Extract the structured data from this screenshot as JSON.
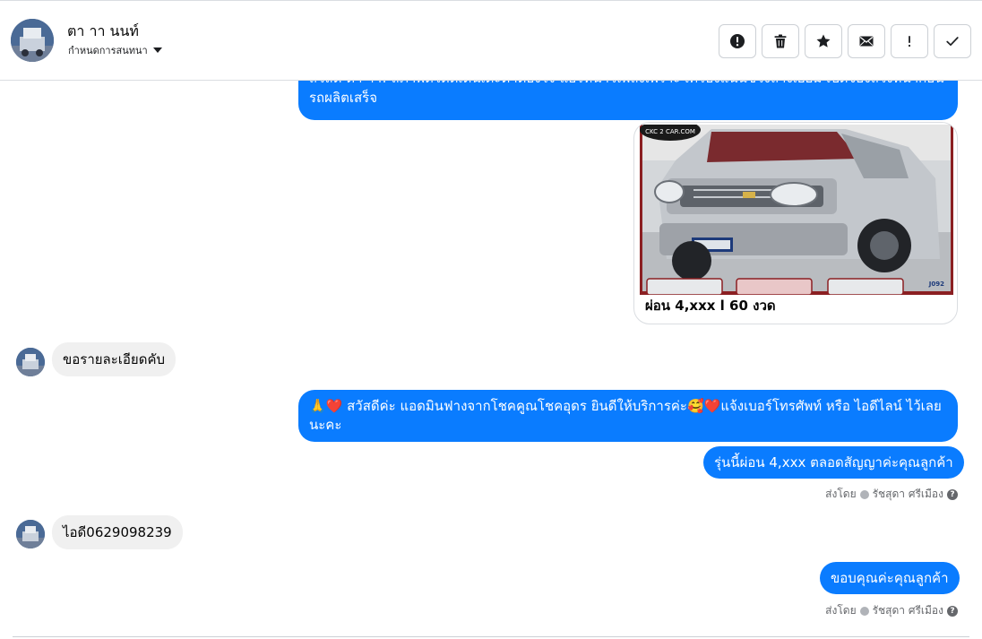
{
  "header": {
    "name": "ตา าา นนท์",
    "assign_label": "กำหนดการสนทนา",
    "toolbar": [
      {
        "name": "report-button",
        "icon": "alert-circle-icon"
      },
      {
        "name": "delete-button",
        "icon": "trash-icon"
      },
      {
        "name": "star-button",
        "icon": "star-icon"
      },
      {
        "name": "mark-unread-button",
        "icon": "envelope-icon"
      },
      {
        "name": "important-button",
        "icon": "exclamation-icon"
      },
      {
        "name": "done-button",
        "icon": "check-icon"
      }
    ]
  },
  "messages": [
    {
      "id": "m1",
      "direction": "out",
      "text_line1": "สวัสดี ตา าา! สภาพดีโดดเด่นเด่ะตาต้องใจ แอร์หนาวเพลงเพราะ เครื่องแน่นช่วงล่างเยี่ยม เปิดจองล่วงหน้าก่อน",
      "text_line2": "รถผลิตเสร็จ"
    },
    {
      "id": "m2",
      "direction": "out",
      "type": "card",
      "image_watermark": "CKC 2 CAR.COM",
      "image_code": "J092",
      "caption": "ผ่อน 4,xxx l 60 งวด"
    },
    {
      "id": "m3",
      "direction": "in",
      "text": "ขอรายละเอียดคับ"
    },
    {
      "id": "m4",
      "direction": "out",
      "emoji_prefix": "🙏❤️",
      "text_line1": " สวัสดีค่ะ แอดมินฟางจากโชคคูณโชคอุดร ยินดีให้บริการค่ะ🥰❤️แจ้งเบอร์โทรศัพท์ หรือ ไอดีไลน์  ไว้เลย",
      "text_line2": "นะคะ"
    },
    {
      "id": "m5",
      "direction": "out",
      "text": "รุ่นนี้ผ่อน 4,xxx ตลอดสัญญาค่ะคุณลูกค้า"
    },
    {
      "id": "m6",
      "direction": "in",
      "text": "ไอดี0629098239"
    },
    {
      "id": "m7",
      "direction": "out",
      "text": "ขอบคุณค่ะคุณลูกค้า"
    }
  ],
  "sent_by": {
    "prefix": "ส่งโดย",
    "agent": "รัชสุดา ศรีเมือง",
    "help": "?"
  },
  "colors": {
    "outgoing_bubble": "#0a7cff",
    "incoming_bubble": "#f0f0f0",
    "avatar_bg": "#3d5a86"
  }
}
